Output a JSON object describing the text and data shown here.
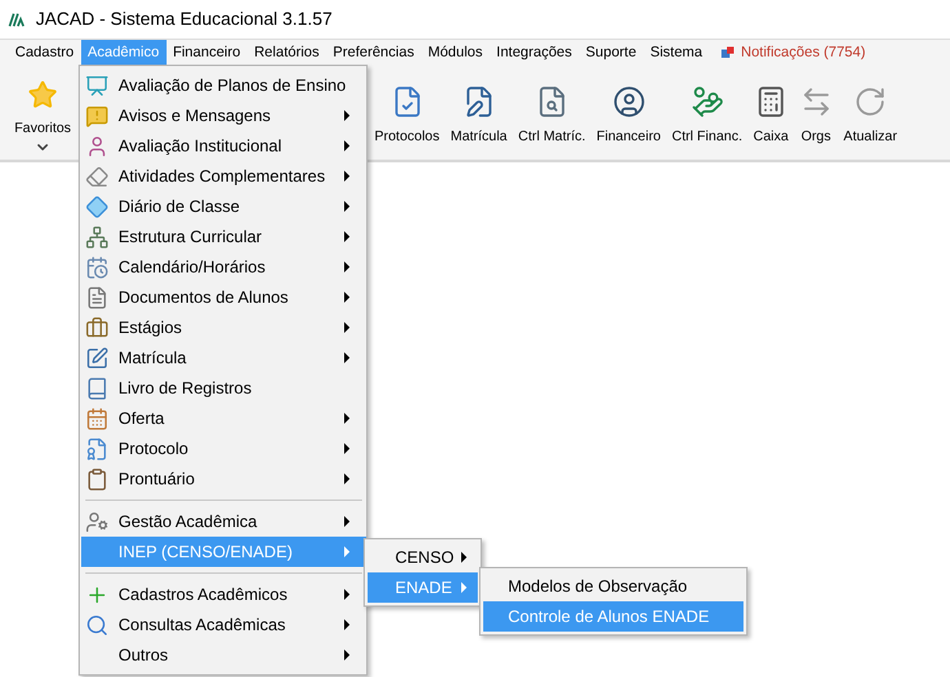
{
  "window": {
    "title": "JACAD - Sistema Educacional 3.1.57"
  },
  "menubar": [
    {
      "label": "Cadastro",
      "selected": false
    },
    {
      "label": "Acadêmico",
      "selected": true
    },
    {
      "label": "Financeiro",
      "selected": false
    },
    {
      "label": "Relatórios",
      "selected": false
    },
    {
      "label": "Preferências",
      "selected": false
    },
    {
      "label": "Módulos",
      "selected": false
    },
    {
      "label": "Integrações",
      "selected": false
    },
    {
      "label": "Suporte",
      "selected": false
    },
    {
      "label": "Sistema",
      "selected": false
    }
  ],
  "notifications": {
    "label": "Notificações (7754)"
  },
  "toolbar": [
    {
      "label": "Favoritos",
      "kind": "favorites"
    },
    {
      "label": "Protocolos",
      "kind": "protocol"
    },
    {
      "label": "Matrícula",
      "kind": "enroll"
    },
    {
      "label": "Ctrl Matríc.",
      "kind": "enroll-control"
    },
    {
      "label": "Financeiro",
      "kind": "finance"
    },
    {
      "label": "Ctrl Financ.",
      "kind": "finance-control"
    },
    {
      "label": "Caixa",
      "kind": "register"
    },
    {
      "label": "Orgs",
      "kind": "orgs"
    },
    {
      "label": "Atualizar",
      "kind": "refresh"
    }
  ],
  "menu": {
    "groups": [
      [
        {
          "label": "Avaliação de Planos de Ensino",
          "submenu": false,
          "selected": false
        },
        {
          "label": "Avisos e Mensagens",
          "submenu": true,
          "selected": false
        },
        {
          "label": "Avaliação Institucional",
          "submenu": true,
          "selected": false
        },
        {
          "label": "Atividades Complementares",
          "submenu": true,
          "selected": false
        },
        {
          "label": "Diário de Classe",
          "submenu": true,
          "selected": false
        },
        {
          "label": "Estrutura Curricular",
          "submenu": true,
          "selected": false
        },
        {
          "label": "Calendário/Horários",
          "submenu": true,
          "selected": false
        },
        {
          "label": "Documentos de Alunos",
          "submenu": true,
          "selected": false
        },
        {
          "label": "Estágios",
          "submenu": true,
          "selected": false
        },
        {
          "label": "Matrícula",
          "submenu": true,
          "selected": false
        },
        {
          "label": "Livro de Registros",
          "submenu": false,
          "selected": false
        },
        {
          "label": "Oferta",
          "submenu": true,
          "selected": false
        },
        {
          "label": "Protocolo",
          "submenu": true,
          "selected": false
        },
        {
          "label": "Prontuário",
          "submenu": true,
          "selected": false
        }
      ],
      [
        {
          "label": "Gestão Acadêmica",
          "submenu": true,
          "selected": false
        },
        {
          "label": "INEP (CENSO/ENADE)",
          "submenu": true,
          "selected": true
        }
      ],
      [
        {
          "label": "Cadastros Acadêmicos",
          "submenu": true,
          "selected": false
        },
        {
          "label": "Consultas Acadêmicas",
          "submenu": true,
          "selected": false
        },
        {
          "label": "Outros",
          "submenu": true,
          "selected": false
        }
      ]
    ]
  },
  "submenu": [
    {
      "label": "CENSO",
      "submenu": true,
      "selected": false
    },
    {
      "label": "ENADE",
      "submenu": true,
      "selected": true
    }
  ],
  "submenu_2": [
    {
      "label": "Modelos de Observação",
      "selected": false
    },
    {
      "label": "Controle de Alunos ENADE",
      "selected": true
    }
  ]
}
